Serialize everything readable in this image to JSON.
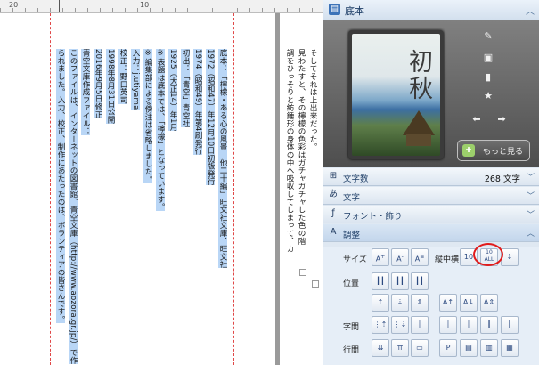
{
  "ruler": {
    "left_num": "20",
    "mid_num": "10"
  },
  "document": {
    "columns": [
      {
        "text": "底本：「檸檬・ある心の風景　他二十編」旺文社文庫、旺文社",
        "highlight": true
      },
      {
        "text": "1972（昭和47）年12月10日初版発行",
        "highlight": true
      },
      {
        "text": "1974（昭和49）年第4刷発行",
        "highlight": true
      },
      {
        "text": "初出：「青空」青空社",
        "highlight": true
      },
      {
        "text": "1925（大正14）年1月",
        "highlight": true
      },
      {
        "text": "※表題は底本では、「檸檬」となっています。",
        "highlight": true
      },
      {
        "text": "※編集部による傍注は省略しました。",
        "highlight": true
      },
      {
        "text": "入力：j.utiyama",
        "highlight": true
      },
      {
        "text": "校正：野口英司",
        "highlight": true
      },
      {
        "text": "1998年8月31日公開",
        "highlight": true
      },
      {
        "text": "2016年9月5日修正",
        "highlight": true
      },
      {
        "text": "青空文庫作成ファイル：",
        "highlight": true
      },
      {
        "text": "このファイルは、インターネットの図書館、青空文庫（http://www.aozora.gr.jp/）で作",
        "highlight": true
      },
      {
        "text": "られました。入力、校正、制作にあたったのは、ボランティアの皆さんです。",
        "highlight": true
      }
    ],
    "page2_columns": [
      {
        "text": "そしてそれは上出来だった。"
      },
      {
        "text": "見わたすと、その檸檬の色彩はガチャガチャした色の階"
      },
      {
        "text": "調をひっそりと紡錘形の身体の中へ吸収してしまって、カ"
      }
    ]
  },
  "panel": {
    "title": "底本",
    "cover_title_line1": "初",
    "cover_title_line2": "秋",
    "more_button": "もっと見る",
    "sections": [
      {
        "icon": "count-icon",
        "label": "文字数",
        "value": "268 文字"
      },
      {
        "icon": "moji-icon",
        "label": "文字",
        "value": ""
      },
      {
        "icon": "font-icon",
        "label": "フォント・飾り",
        "value": ""
      },
      {
        "icon": "adjust-icon",
        "label": "調整",
        "value": ""
      }
    ],
    "adjust": {
      "size_label": "サイズ",
      "tatechuyoko_label": "縦中横",
      "position_label": "位置",
      "char_spacing_label": "字間",
      "line_spacing_label": "行間",
      "tcy_button_1": "10",
      "tcy_button_2": "10 ALL",
      "tcy_button_3": "↕"
    }
  },
  "colors": {
    "highlight": "#b9d6f6",
    "panel_bg": "#dfe8f2",
    "annotation": "#e11b1b",
    "margin_line": "#e04848"
  }
}
